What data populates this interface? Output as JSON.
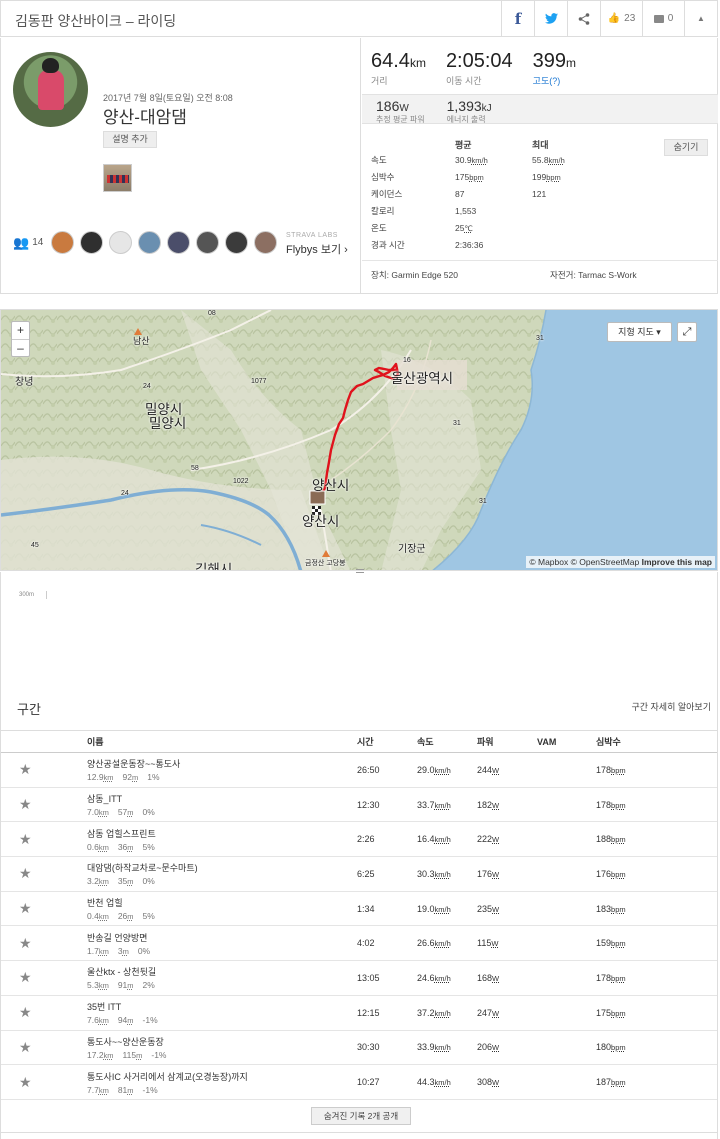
{
  "header": {
    "title": "김동판 양산바이크 – 라이딩",
    "kudos_count": "23",
    "comments_count": "0"
  },
  "activity": {
    "date": "2017년 7월 8일(토요일) 오전 8:08",
    "title": "양산-대암댐",
    "add_description": "설명 추가"
  },
  "athletes": {
    "count": "14",
    "labs": "STRAVA LABS",
    "flybys": "Flybys 보기 ›"
  },
  "stats": {
    "distance": {
      "value": "64.4",
      "unit": "km",
      "label": "거리"
    },
    "moving_time": {
      "value": "2:05:04",
      "label": "이동 시간"
    },
    "elevation": {
      "value": "399",
      "unit": "m",
      "label": "고도(?)"
    },
    "avg_power": {
      "value": "186",
      "unit": "W",
      "label": "추정 평균 파워"
    },
    "energy": {
      "value": "1,393",
      "unit": "kJ",
      "label": "에너지 출력"
    }
  },
  "detail": {
    "avg_header": "평균",
    "max_header": "최대",
    "hide_label": "숨기기",
    "rows": [
      {
        "label": "속도",
        "avg": "30.9",
        "avg_unit": "km/h",
        "max": "55.8",
        "max_unit": "km/h"
      },
      {
        "label": "심박수",
        "avg": "175",
        "avg_unit": "bpm",
        "max": "199",
        "max_unit": "bpm"
      },
      {
        "label": "케이던스",
        "avg": "87",
        "avg_unit": "",
        "max": "121",
        "max_unit": ""
      },
      {
        "label": "칼로리",
        "avg": "1,553",
        "avg_unit": "",
        "max": "",
        "max_unit": ""
      },
      {
        "label": "온도",
        "avg": "25",
        "avg_unit": "℃",
        "max": "",
        "max_unit": ""
      },
      {
        "label": "경과 시간",
        "avg": "2:36:36",
        "avg_unit": "",
        "max": "",
        "max_unit": ""
      }
    ],
    "device": "장치: Garmin Edge 520",
    "bike": "자전거: Tarmac S-Work"
  },
  "map": {
    "zoom_in": "+",
    "zoom_out": "–",
    "terrain": "지형 지도 ▾",
    "fullscreen": "⤢",
    "attribution_mapbox": "© Mapbox © OpenStreetMap",
    "attribution_improve": "Improve this map",
    "labels": {
      "ulsan": "울산광역시",
      "miryang": "밀양시",
      "miryang2": "밀양시",
      "yangsan": "양산시",
      "yangsan2": "양산시",
      "changnyeong": "창녕",
      "gijang": "기장군",
      "gimhae": "김해시",
      "namsan": "남산",
      "geumjeong": "금정산 고당봉",
      "r1077": "1077",
      "r1022": "1022",
      "r58": "58",
      "r24": "24",
      "r16": "16",
      "r31": "31",
      "r31b": "31",
      "r45": "45",
      "r24b": "24",
      "r08": "08",
      "r31c": "31"
    }
  },
  "elevation_axis": {
    "tick": "300m"
  },
  "segments": {
    "title": "구간",
    "learn_more": "구간 자세히 알아보기",
    "columns": {
      "name": "이름",
      "time": "시간",
      "speed": "속도",
      "power": "파워",
      "vam": "VAM",
      "hr": "심박수"
    },
    "rows": [
      {
        "name": "양산공설운동장~~통도사",
        "dist": "12.9",
        "elev": "92",
        "grade": "1",
        "time": "26:50",
        "speed": "29.0",
        "power": "244",
        "hr": "178"
      },
      {
        "name": "삼동_ITT",
        "dist": "7.0",
        "elev": "57",
        "grade": "0",
        "time": "12:30",
        "speed": "33.7",
        "power": "182",
        "hr": "178"
      },
      {
        "name": "삼동 업힐스프린트",
        "dist": "0.6",
        "elev": "36",
        "grade": "5",
        "time": "2:26",
        "speed": "16.4",
        "power": "222",
        "hr": "188"
      },
      {
        "name": "대암댐(하작교차로~문수마트)",
        "dist": "3.2",
        "elev": "35",
        "grade": "0",
        "time": "6:25",
        "speed": "30.3",
        "power": "176",
        "hr": "176"
      },
      {
        "name": "반천 업힐",
        "dist": "0.4",
        "elev": "26",
        "grade": "5",
        "time": "1:34",
        "speed": "19.0",
        "power": "235",
        "hr": "183"
      },
      {
        "name": "반송길 언양방면",
        "dist": "1.7",
        "elev": "3",
        "grade": "0",
        "time": "4:02",
        "speed": "26.6",
        "power": "115",
        "hr": "159"
      },
      {
        "name": "울산ktx - 상천뒷길",
        "dist": "5.3",
        "elev": "91",
        "grade": "2",
        "time": "13:05",
        "speed": "24.6",
        "power": "168",
        "hr": "178"
      },
      {
        "name": "35번 ITT",
        "dist": "7.6",
        "elev": "94",
        "grade": "-1",
        "time": "12:15",
        "speed": "37.2",
        "power": "247",
        "hr": "175"
      },
      {
        "name": "통도사~~양산운동장",
        "dist": "17.2",
        "elev": "115",
        "grade": "-1",
        "time": "30:30",
        "speed": "33.9",
        "power": "206",
        "hr": "180"
      },
      {
        "name": "통도사IC 사거리에서 삼계교(오경농장)까지",
        "dist": "7.7",
        "elev": "81",
        "grade": "-1",
        "time": "10:27",
        "speed": "44.3",
        "power": "308",
        "hr": "187"
      }
    ],
    "units": {
      "km": "km",
      "m": "m",
      "pct": "%",
      "kmh": "km/h",
      "w": "W",
      "bpm": "bpm"
    },
    "show_hidden": "숨겨진 기록 2개 공개"
  }
}
